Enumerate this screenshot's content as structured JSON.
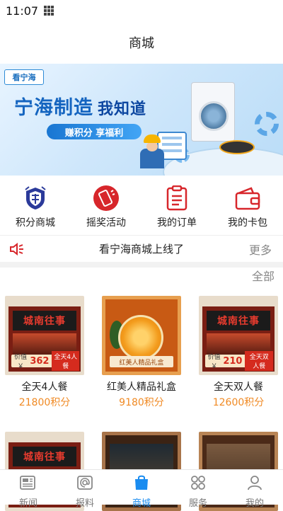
{
  "status_bar": {
    "time": "11:07"
  },
  "header": {
    "title": "商城"
  },
  "banner": {
    "logo_text": "看宁海",
    "headline": "宁海制造",
    "headline_sub": "我知道",
    "pill": "赚积分 享福利"
  },
  "quick_nav": [
    {
      "label": "积分商城",
      "icon": "points-mall-badge-icon"
    },
    {
      "label": "摇奖活动",
      "icon": "lottery-shake-icon"
    },
    {
      "label": "我的订单",
      "icon": "order-list-icon"
    },
    {
      "label": "我的卡包",
      "icon": "card-wallet-icon"
    }
  ],
  "notice": {
    "text": "看宁海商城上线了",
    "more": "更多"
  },
  "filter": {
    "all_label": "全部"
  },
  "products": [
    {
      "name": "全天4人餐",
      "price": "21800积分",
      "sign": "城南往事",
      "deal_prefix": "价值￥",
      "deal_value": "362",
      "deal_tag": "全天4人餐"
    },
    {
      "name": "红美人精品礼盒",
      "price": "9180积分",
      "tag": "红美人精品礼盒"
    },
    {
      "name": "全天双人餐",
      "price": "12600积分",
      "sign": "城南往事",
      "deal_prefix": "价值￥",
      "deal_value": "210",
      "deal_tag": "全天双人餐"
    }
  ],
  "second_row": [
    {
      "sign": "城南往事"
    },
    {},
    {}
  ],
  "tabbar": [
    {
      "label": "新闻",
      "icon": "newspaper-icon"
    },
    {
      "label": "报料",
      "icon": "report-at-icon"
    },
    {
      "label": "商城",
      "icon": "shopping-bag-icon",
      "active": true
    },
    {
      "label": "服务",
      "icon": "services-grid-icon"
    },
    {
      "label": "我的",
      "icon": "user-profile-icon"
    }
  ],
  "colors": {
    "accent": "#1a8cf0",
    "price": "#f08a24",
    "lottery_red": "#d7262b"
  }
}
